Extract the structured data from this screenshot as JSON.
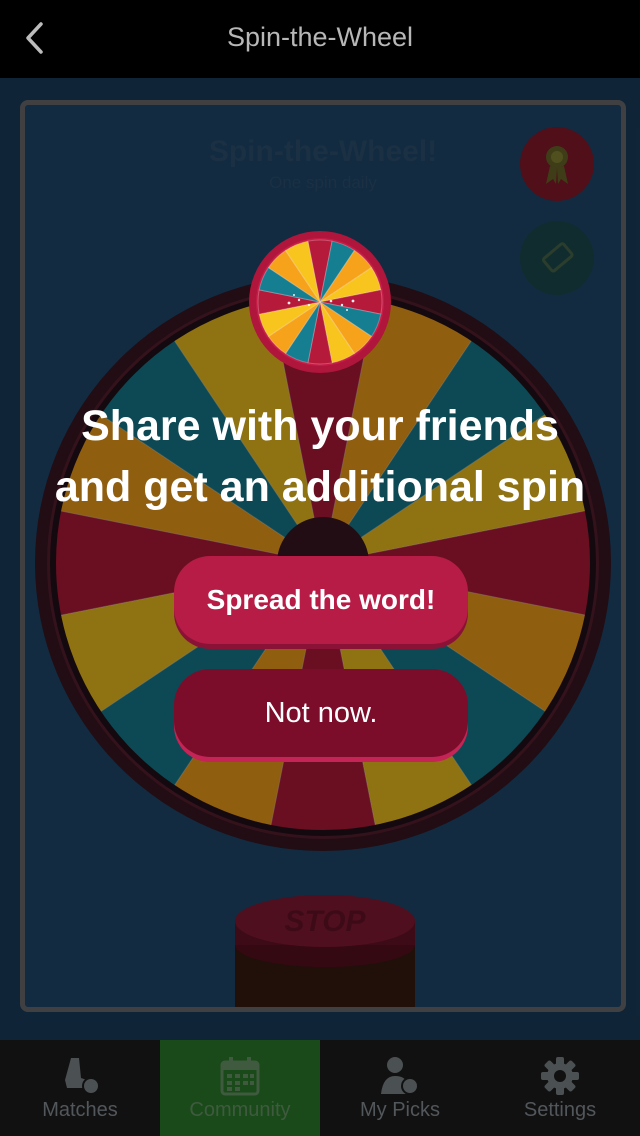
{
  "header": {
    "title": "Spin-the-Wheel",
    "back_icon": "chevron-left-icon"
  },
  "game": {
    "title": "Spin-the-Wheel!",
    "subtitle": "One spin daily",
    "stop_label": "STOP",
    "side_buttons": [
      {
        "icon": "award-ribbon-icon",
        "color": "#8a1a2c"
      },
      {
        "icon": "ticket-icon",
        "color": "#1c4d52"
      }
    ]
  },
  "dialog": {
    "headline_line1": "Share with your friends",
    "headline_line2": "and get an additional spin",
    "primary_button": "Spread the word!",
    "secondary_button": "Not now."
  },
  "tabs": [
    {
      "label": "Matches",
      "icon": "soccer-cleat-icon",
      "active": false
    },
    {
      "label": "Community",
      "icon": "calendar-icon",
      "active": true
    },
    {
      "label": "My Picks",
      "icon": "player-ball-icon",
      "active": false
    },
    {
      "label": "Settings",
      "icon": "gear-icon",
      "active": false
    }
  ],
  "colors": {
    "accent": "#b61c45",
    "accent_dark": "#7b0d2b",
    "active_tab": "#1a4a1a",
    "wheel_segments": [
      "#f6a21a",
      "#f7c51e",
      "#157f91",
      "#b51a3a"
    ]
  }
}
